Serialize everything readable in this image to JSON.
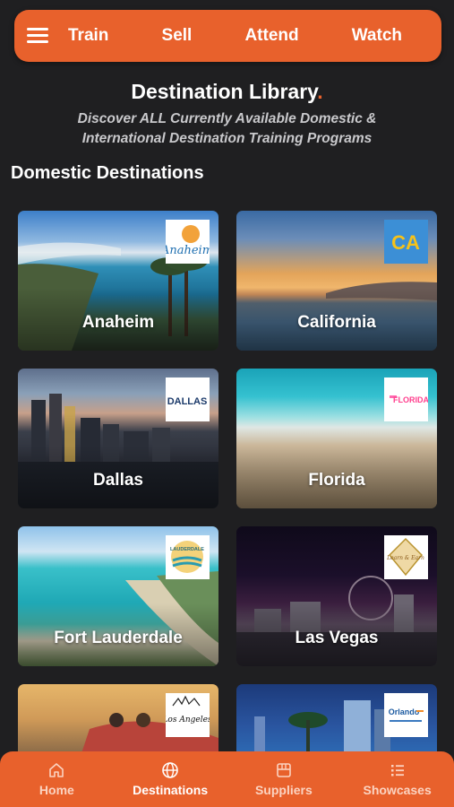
{
  "topnav": {
    "menu_icon": "hamburger-menu-icon",
    "items": [
      "Train",
      "Sell",
      "Attend",
      "Watch"
    ]
  },
  "header": {
    "title": "Destination Library",
    "title_dot": ".",
    "subtitle_line1": "Discover ALL Currently Available Domestic  &",
    "subtitle_line2": "International Destination Training Programs"
  },
  "section": {
    "heading": "Domestic Destinations"
  },
  "destinations": [
    {
      "name": "Anaheim",
      "logo_text": "Anaheim"
    },
    {
      "name": "California",
      "logo_text": "CA"
    },
    {
      "name": "Dallas",
      "logo_text": "DALLAS"
    },
    {
      "name": "Florida",
      "logo_text": "FLORIDA"
    },
    {
      "name": "Fort Lauderdale",
      "logo_text": "LAUDERDALE"
    },
    {
      "name": "Las Vegas",
      "logo_text": "Learn & Earn"
    },
    {
      "name": "",
      "logo_text": "Los Angeles"
    },
    {
      "name": "",
      "logo_text": "Orlando"
    }
  ],
  "bottomnav": {
    "items": [
      {
        "label": "Home",
        "icon": "home-icon"
      },
      {
        "label": "Destinations",
        "icon": "globe-icon"
      },
      {
        "label": "Suppliers",
        "icon": "box-icon"
      },
      {
        "label": "Showcases",
        "icon": "list-icon"
      }
    ],
    "active": "Destinations"
  },
  "colors": {
    "accent": "#e8612c",
    "background": "#1f1f21"
  }
}
